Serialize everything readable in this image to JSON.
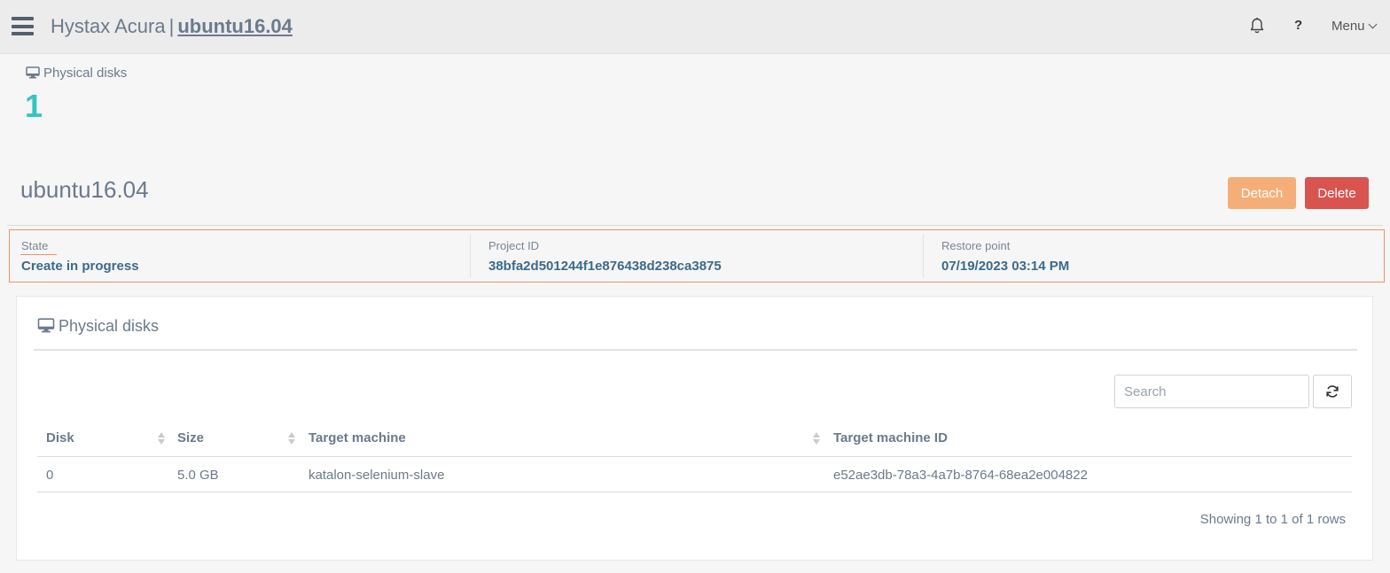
{
  "header": {
    "app_name": "Hystax Acura",
    "separator": "|",
    "machine_link": "ubuntu16.04",
    "help_label": "?",
    "menu_label": "Menu"
  },
  "summary": {
    "label": "Physical disks",
    "count": "1"
  },
  "page": {
    "title": "ubuntu16.04",
    "detach_label": "Detach",
    "delete_label": "Delete",
    "detach_color": "#f5ae78",
    "delete_color": "#d9534f"
  },
  "info": {
    "state_label": "State",
    "state_value": "Create in progress",
    "project_label": "Project ID",
    "project_value": "38bfa2d501244f1e876438d238ca3875",
    "restore_label": "Restore point",
    "restore_value": "07/19/2023 03:14 PM"
  },
  "disks_panel": {
    "title": "Physical disks",
    "search_placeholder": "Search",
    "columns": [
      "Disk",
      "Size",
      "Target machine",
      "Target machine ID"
    ],
    "rows": [
      [
        "0",
        "5.0 GB",
        "katalon-selenium-slave",
        "e52ae3db-78a3-4a7b-8764-68ea2e004822"
      ]
    ],
    "footer": "Showing 1 to 1 of 1 rows"
  },
  "icons": {
    "menu": "hamburger-icon",
    "notifications": "bell-icon",
    "disks": "monitor-icon",
    "refresh": "refresh-icon"
  },
  "colors": {
    "accent_count": "#36c4c0",
    "info_border": "#f0936a",
    "value_text": "#3b6a8c"
  }
}
